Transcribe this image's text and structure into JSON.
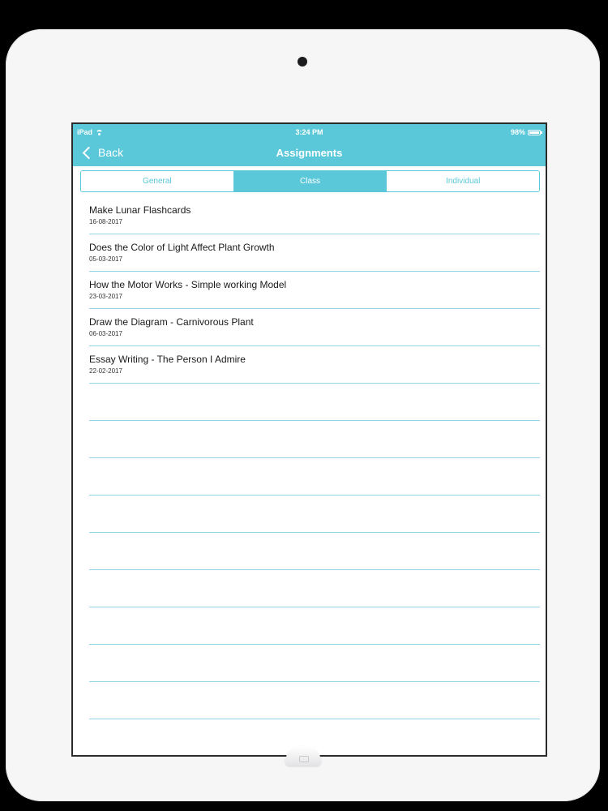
{
  "status_bar": {
    "carrier": "iPad",
    "time": "3:24 PM",
    "battery": "98%"
  },
  "nav": {
    "back_label": "Back",
    "title": "Assignments"
  },
  "tabs": [
    {
      "label": "General",
      "selected": false
    },
    {
      "label": "Class",
      "selected": true
    },
    {
      "label": "Individual",
      "selected": false
    }
  ],
  "assignments": [
    {
      "title": "Make Lunar Flashcards",
      "date": "16-08-2017"
    },
    {
      "title": "Does the Color of Light Affect Plant Growth",
      "date": "05-03-2017"
    },
    {
      "title": "How the Motor Works - Simple working Model",
      "date": "23-03-2017"
    },
    {
      "title": "Draw the Diagram - Carnivorous Plant",
      "date": "06-03-2017"
    },
    {
      "title": "Essay Writing - The Person I Admire",
      "date": "22-02-2017"
    }
  ],
  "colors": {
    "accent": "#5bc8da",
    "separator": "#8fd8e4",
    "device_frame": "#f6f6f7"
  }
}
